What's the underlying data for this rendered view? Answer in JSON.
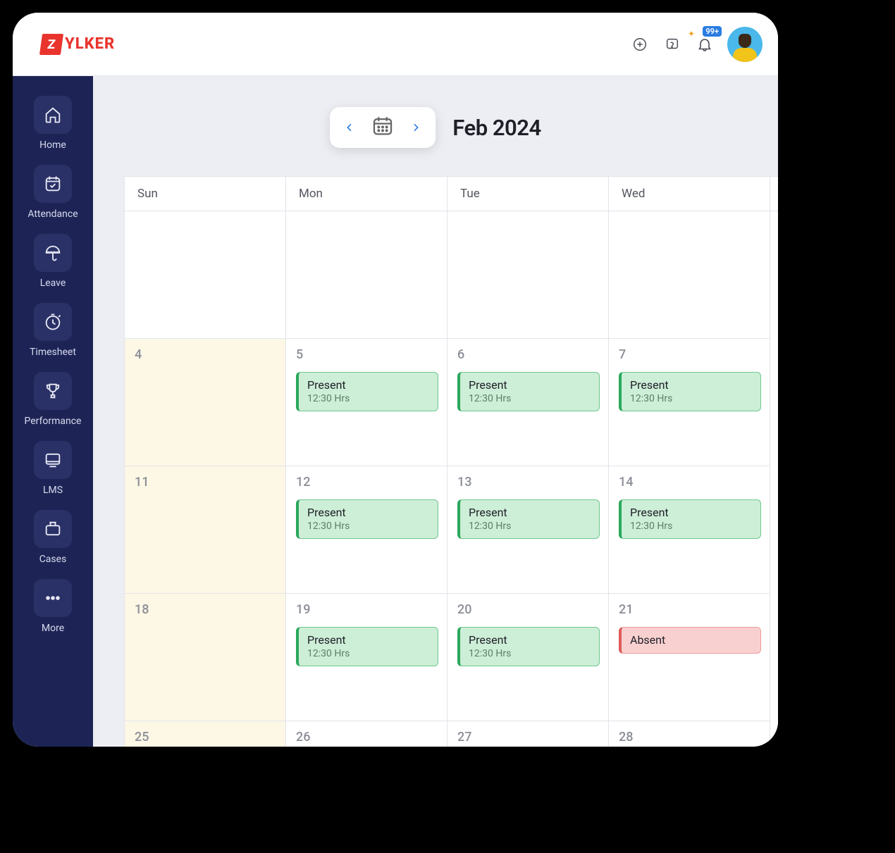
{
  "brand": {
    "mark": "Z",
    "text": "YLKER"
  },
  "topbar": {
    "notif_count": "99+"
  },
  "sidebar": {
    "items": [
      {
        "label": "Home",
        "icon": "home"
      },
      {
        "label": "Attendance",
        "icon": "calendar-check"
      },
      {
        "label": "Leave",
        "icon": "umbrella"
      },
      {
        "label": "Timesheet",
        "icon": "clock"
      },
      {
        "label": "Performance",
        "icon": "trophy"
      },
      {
        "label": "LMS",
        "icon": "screen"
      },
      {
        "label": "Cases",
        "icon": "folder"
      },
      {
        "label": "More",
        "icon": "dots"
      }
    ]
  },
  "calendar": {
    "month_label": "Feb 2024",
    "day_headers": [
      "Sun",
      "Mon",
      "Tue",
      "Wed"
    ],
    "rows": [
      {
        "cells": [
          {
            "day": "",
            "weekend": false
          },
          {
            "day": "",
            "weekend": false
          },
          {
            "day": "",
            "weekend": false
          },
          {
            "day": "",
            "weekend": false
          }
        ]
      },
      {
        "cells": [
          {
            "day": "4",
            "weekend": true
          },
          {
            "day": "5",
            "event": {
              "type": "present",
              "title": "Present",
              "sub": "12:30 Hrs"
            }
          },
          {
            "day": "6",
            "event": {
              "type": "present",
              "title": "Present",
              "sub": "12:30 Hrs"
            }
          },
          {
            "day": "7",
            "event": {
              "type": "present",
              "title": "Present",
              "sub": "12:30 Hrs"
            }
          }
        ]
      },
      {
        "cells": [
          {
            "day": "11",
            "weekend": true
          },
          {
            "day": "12",
            "event": {
              "type": "present",
              "title": "Present",
              "sub": "12:30 Hrs"
            }
          },
          {
            "day": "13",
            "event": {
              "type": "present",
              "title": "Present",
              "sub": "12:30 Hrs"
            }
          },
          {
            "day": "14",
            "event": {
              "type": "present",
              "title": "Present",
              "sub": "12:30 Hrs"
            }
          }
        ]
      },
      {
        "cells": [
          {
            "day": "18",
            "weekend": true
          },
          {
            "day": "19",
            "event": {
              "type": "present",
              "title": "Present",
              "sub": "12:30 Hrs"
            }
          },
          {
            "day": "20",
            "event": {
              "type": "present",
              "title": "Present",
              "sub": "12:30 Hrs"
            }
          },
          {
            "day": "21",
            "event": {
              "type": "absent",
              "title": "Absent"
            }
          }
        ]
      },
      {
        "cells": [
          {
            "day": "25",
            "weekend": true
          },
          {
            "day": "26"
          },
          {
            "day": "27"
          },
          {
            "day": "28"
          }
        ]
      }
    ]
  }
}
